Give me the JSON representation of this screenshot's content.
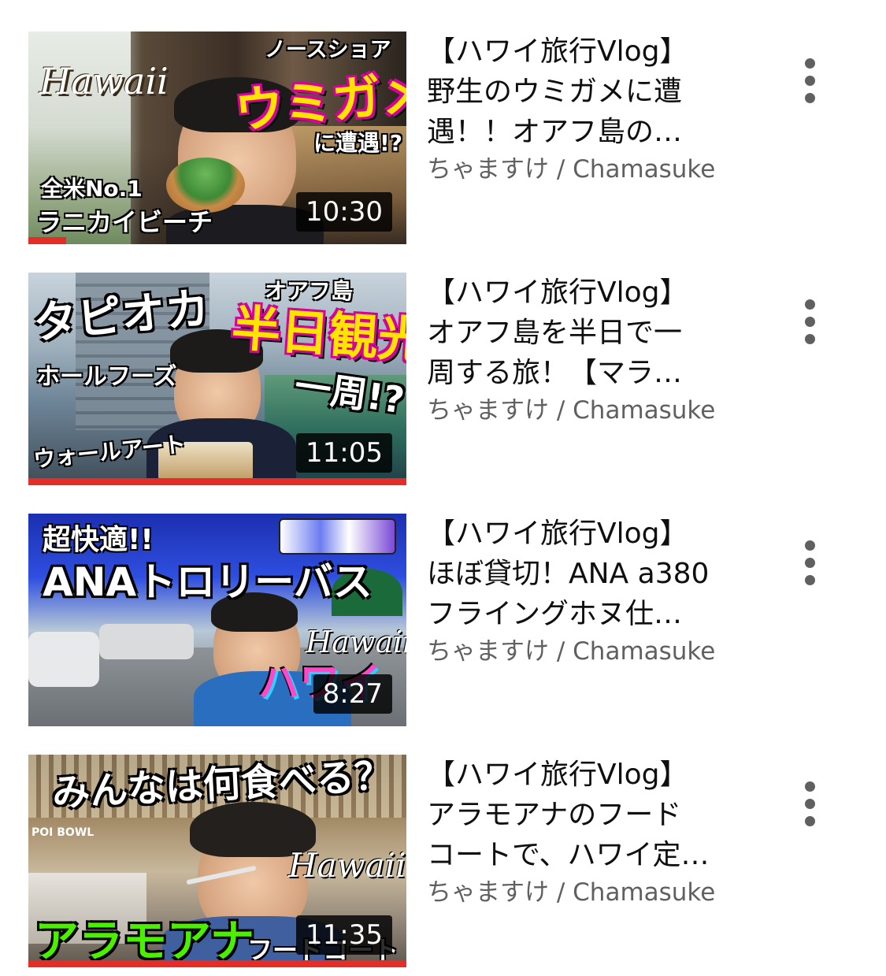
{
  "videos": [
    {
      "duration": "10:30",
      "progress": 0.1,
      "title_lines": [
        "【ハワイ旅行Vlog】",
        "野生のウミガメに遭",
        "遇！！オアフ島の…"
      ],
      "channel": "ちゃますけ / Chamasuke",
      "thumb_text": {
        "a": "Hawaii",
        "b": "ノースショア",
        "c": "ウミガメ",
        "d": "に遭遇!?",
        "e": "全米No.1",
        "f": "ラニカイビーチ"
      },
      "menu_icon": "three-dots-vertical"
    },
    {
      "duration": "11:05",
      "progress": 1.0,
      "title_lines": [
        "【ハワイ旅行Vlog】",
        "オアフ島を半日で一",
        "周する旅！【マラ…"
      ],
      "channel": "ちゃますけ / Chamasuke",
      "thumb_text": {
        "a": "タピオカ",
        "b": "オアフ島",
        "c": "半日観光",
        "d": "ホールフーズ",
        "e": "一周!?",
        "f": "ウォールアート"
      },
      "menu_icon": "three-dots-vertical"
    },
    {
      "duration": "8:27",
      "progress": 0,
      "title_lines": [
        "【ハワイ旅行Vlog】",
        "ほぼ貸切！ANA a380",
        "フライングホヌ仕…"
      ],
      "channel": "ちゃますけ / Chamasuke",
      "thumb_text": {
        "a": "超快適!!",
        "b": "ANAトロリーバス",
        "c": "Hawaii",
        "d": "ハワイ"
      },
      "menu_icon": "three-dots-vertical"
    },
    {
      "duration": "11:35",
      "progress": 1.0,
      "title_lines": [
        "【ハワイ旅行Vlog】",
        "アラモアナのフード",
        "コートで、ハワイ定…"
      ],
      "channel": "ちゃますけ / Chamasuke",
      "thumb_text": {
        "a": "みんなは何食べる？",
        "b": "Hawaii",
        "c": "アラモアナ",
        "d": "フードコート",
        "e": "POI BOWL"
      },
      "menu_icon": "three-dots-vertical"
    }
  ],
  "colors": {
    "progress": "#e52d27",
    "title": "#0f0f0f",
    "channel": "#606060"
  }
}
